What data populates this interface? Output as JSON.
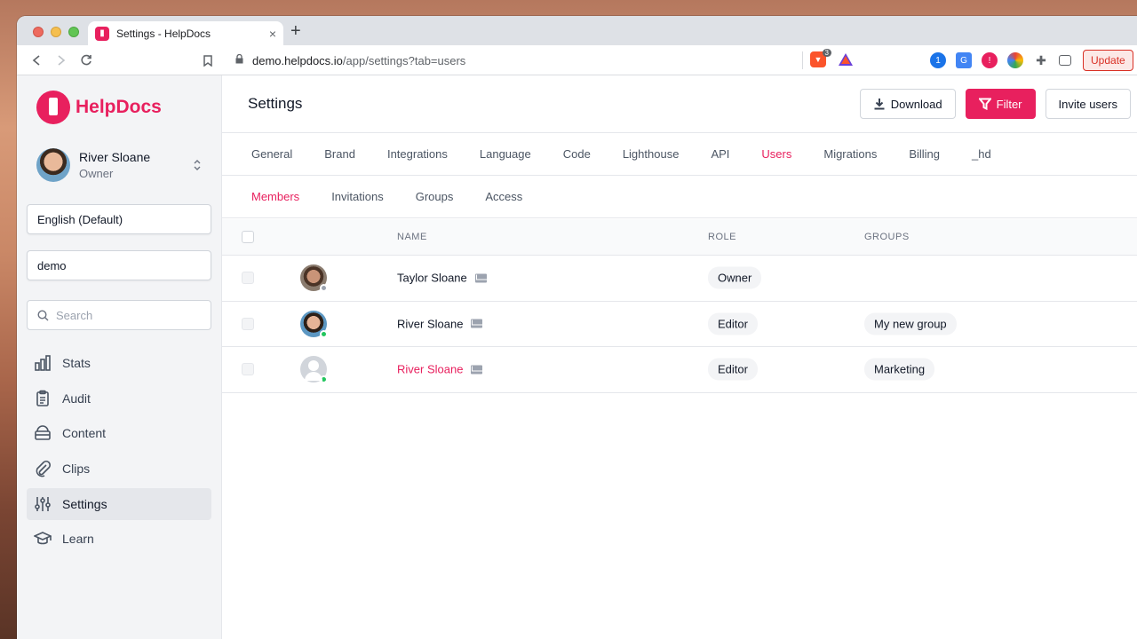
{
  "browser": {
    "tab_title": "Settings - HelpDocs",
    "new_tab_symbol": "+",
    "close_symbol": "×",
    "url_host": "demo.helpdocs.io",
    "url_path": "/app/settings?tab=users",
    "brave_badge": "3",
    "update_label": "Update"
  },
  "sidebar": {
    "logo_text": "HelpDocs",
    "user": {
      "name": "River Sloane",
      "role": "Owner"
    },
    "language_select": "English (Default)",
    "site_select": "demo",
    "search_placeholder": "Search",
    "items": [
      {
        "label": "Stats",
        "icon": "chart-icon"
      },
      {
        "label": "Audit",
        "icon": "clipboard-icon"
      },
      {
        "label": "Content",
        "icon": "archive-icon"
      },
      {
        "label": "Clips",
        "icon": "paperclip-icon"
      },
      {
        "label": "Settings",
        "icon": "sliders-icon",
        "active": true
      },
      {
        "label": "Learn",
        "icon": "graduation-cap-icon"
      }
    ]
  },
  "header": {
    "title": "Settings",
    "download_label": "Download",
    "filter_label": "Filter",
    "invite_label": "Invite users"
  },
  "tabs": [
    "General",
    "Brand",
    "Integrations",
    "Language",
    "Code",
    "Lighthouse",
    "API",
    "Users",
    "Migrations",
    "Billing",
    "_hd"
  ],
  "active_tab": "Users",
  "subtabs": [
    "Members",
    "Invitations",
    "Groups",
    "Access"
  ],
  "active_subtab": "Members",
  "table": {
    "columns": {
      "name": "NAME",
      "role": "ROLE",
      "groups": "GROUPS"
    },
    "rows": [
      {
        "name": "Taylor Sloane",
        "role": "Owner",
        "group": "",
        "status": "offline"
      },
      {
        "name": "River Sloane",
        "role": "Editor",
        "group": "My new group",
        "status": "online"
      },
      {
        "name": "River Sloane",
        "role": "Editor",
        "group": "Marketing",
        "status": "online",
        "highlighted": true
      }
    ]
  },
  "colors": {
    "brand": "#e8205e",
    "online": "#22c55e",
    "offline": "#9ca3af"
  }
}
